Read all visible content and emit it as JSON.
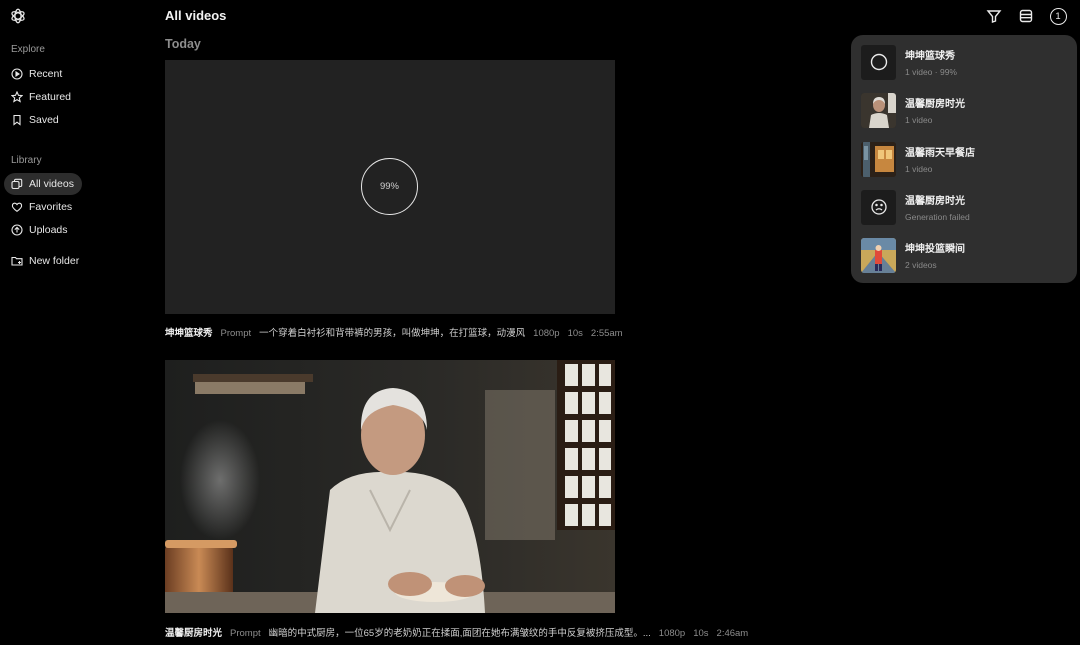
{
  "sidebar": {
    "explore_label": "Explore",
    "explore_items": [
      {
        "label": "Recent",
        "icon": "play-circle-icon"
      },
      {
        "label": "Featured",
        "icon": "star-icon"
      },
      {
        "label": "Saved",
        "icon": "bookmark-icon"
      }
    ],
    "library_label": "Library",
    "library_items": [
      {
        "label": "All videos",
        "icon": "videos-icon",
        "active": true
      },
      {
        "label": "Favorites",
        "icon": "heart-icon"
      },
      {
        "label": "Uploads",
        "icon": "upload-icon"
      }
    ],
    "new_folder_label": "New folder"
  },
  "header": {
    "title": "All videos",
    "queue_count": "1",
    "icons": [
      "filter-icon",
      "layout-icon",
      "queue-count-badge"
    ]
  },
  "feed": {
    "group_label": "Today",
    "items": [
      {
        "title": "坤坤篮球秀",
        "prompt_label": "Prompt",
        "prompt": "一个穿着白衬衫和背带裤的男孩，叫做坤坤，在打篮球，动漫风",
        "resolution": "1080p",
        "duration": "10s",
        "time": "2:55am",
        "progress_label": "99%",
        "progress": 0.99
      },
      {
        "title": "温馨厨房时光",
        "prompt_label": "Prompt",
        "prompt": "幽暗的中式厨房，一位65岁的老奶奶正在揉面,面团在她布满皱纹的手中反复被挤压成型。...",
        "resolution": "1080p",
        "duration": "10s",
        "time": "2:46am"
      }
    ]
  },
  "queue_panel": {
    "items": [
      {
        "title": "坤坤篮球秀",
        "subtitle": "1 video · 99%",
        "thumb": "progress-ring-icon"
      },
      {
        "title": "温馨厨房时光",
        "subtitle": "1 video",
        "thumb": "grandma-thumbnail"
      },
      {
        "title": "温馨雨天早餐店",
        "subtitle": "1 video",
        "thumb": "breakfast-shop-thumbnail"
      },
      {
        "title": "温馨厨房时光",
        "subtitle": "Generation failed",
        "thumb": "sad-face-icon"
      },
      {
        "title": "坤坤投篮瞬间",
        "subtitle": "2 videos",
        "thumb": "basketball-court-thumbnail"
      }
    ]
  },
  "colors": {
    "background": "#000000",
    "panel": "#2f2f2f",
    "active_nav": "#2d2d2d",
    "placeholder": "#222222"
  }
}
